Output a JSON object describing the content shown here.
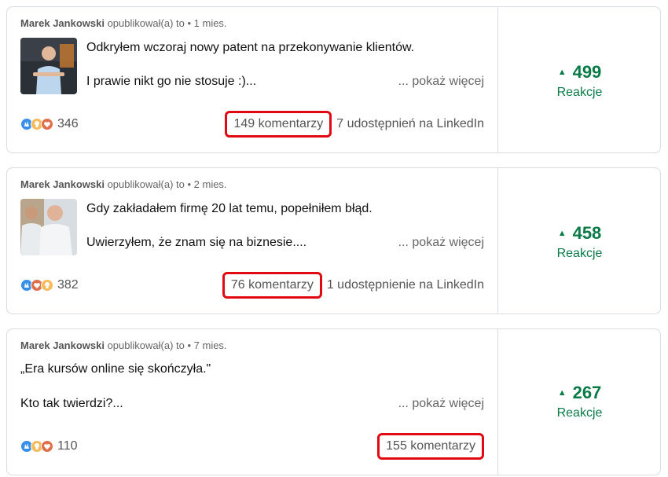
{
  "posts": [
    {
      "author": "Marek Jankowski",
      "posted_text": "opublikował(a) to",
      "time": "• 1 mies.",
      "line1": "Odkryłem wczoraj nowy patent na przekonywanie klientów.",
      "line2": "I prawie nikt go nie stosuje :)...",
      "more": "... pokaż więcej",
      "reactions_count": "346",
      "comments": "149 komentarzy",
      "shares": "7 udostępnień na LinkedIn",
      "growth": "499",
      "growth_label": "Reakcje",
      "reaction_icons": [
        "clap-icon",
        "bulb-icon",
        "heart-icon"
      ]
    },
    {
      "author": "Marek Jankowski",
      "posted_text": "opublikował(a) to",
      "time": "• 2 mies.",
      "line1": "Gdy zakładałem firmę 20 lat temu, popełniłem błąd.",
      "line2": "Uwierzyłem, że znam się na biznesie....",
      "more": "... pokaż więcej",
      "reactions_count": "382",
      "comments": "76 komentarzy",
      "shares": "1 udostępnienie na LinkedIn",
      "growth": "458",
      "growth_label": "Reakcje",
      "reaction_icons": [
        "clap-icon",
        "heart-icon",
        "bulb-icon"
      ]
    },
    {
      "author": "Marek Jankowski",
      "posted_text": "opublikował(a) to",
      "time": "• 7 mies.",
      "line1": "„Era kursów online się skończyła.\"",
      "line2": "Kto tak twierdzi?...",
      "more": "... pokaż więcej",
      "reactions_count": "110",
      "comments": "155 komentarzy",
      "shares": "",
      "growth": "267",
      "growth_label": "Reakcje",
      "reaction_icons": [
        "clap-icon",
        "bulb-icon",
        "heart-icon"
      ]
    }
  ],
  "colors": {
    "accent_green": "#0a7a47",
    "highlight_red": "#e10a12",
    "border": "#d9dcdf"
  }
}
